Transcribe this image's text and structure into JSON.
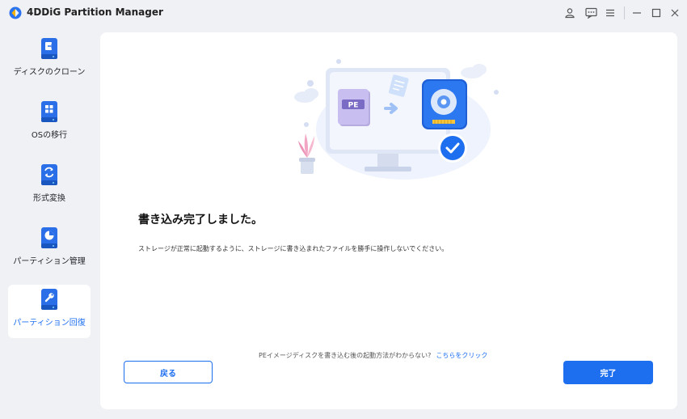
{
  "app": {
    "title": "4DDiG Partition Manager"
  },
  "sidebar": {
    "items": [
      {
        "label": "ディスクのクローン",
        "icon": "disk-clone-icon",
        "active": false
      },
      {
        "label": "OSの移行",
        "icon": "os-migration-icon",
        "active": false
      },
      {
        "label": "形式変換",
        "icon": "format-convert-icon",
        "active": false
      },
      {
        "label": "パーティション管理",
        "icon": "partition-manage-icon",
        "active": false
      },
      {
        "label": "パーティション回復",
        "icon": "partition-recovery-icon",
        "active": true
      }
    ]
  },
  "main": {
    "pe_label": "PE",
    "heading": "書き込み完了しました。",
    "description": "ストレージが正常に起動するように、ストレージに書き込まれたファイルを勝手に操作しないでください。",
    "help_text": "PEイメージディスクを書き込む後の起動方法がわからない?",
    "help_link": "こちらをクリック",
    "back_label": "戻る",
    "done_label": "完了"
  },
  "colors": {
    "accent": "#1e6ff0",
    "sidebar_bg": "#f0f1f5",
    "card_bg": "#ffffff"
  }
}
